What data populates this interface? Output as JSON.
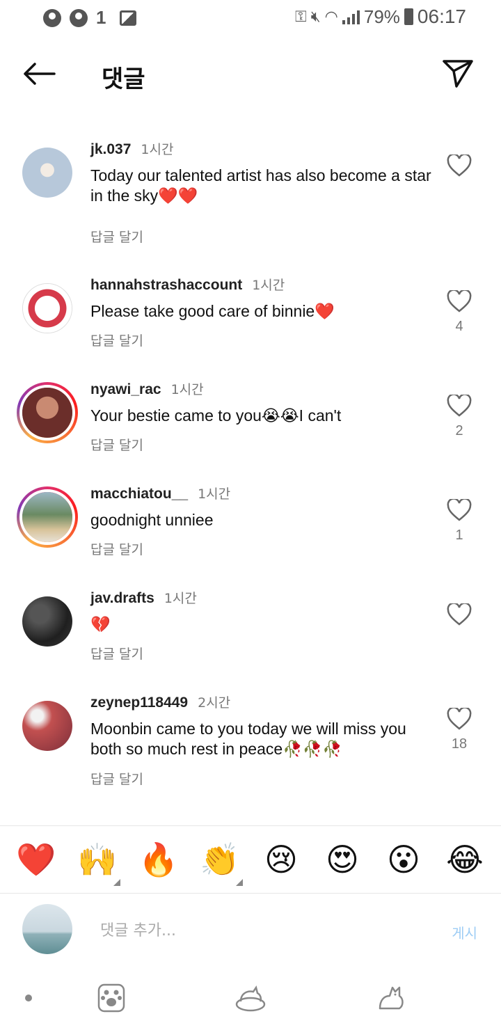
{
  "status_bar": {
    "notif_count": "1",
    "battery": "79%",
    "time": "06:17"
  },
  "header": {
    "title": "댓글"
  },
  "comments": [
    {
      "username": "jk.037",
      "time": "1시간",
      "text": "Today our talented artist has also become a star in the sky❤️❤️",
      "reply_label": "답글 달기",
      "likes": "",
      "avatar_color": "#b9c9d9"
    },
    {
      "username": "hannahstrashaccount",
      "time": "1시간",
      "text": "Please take good care of binnie❤️",
      "reply_label": "답글 달기",
      "likes": "4",
      "avatar_color": "#f1d6da"
    },
    {
      "username": "nyawi_rac",
      "time": "1시간",
      "text": "Your bestie came to you😭😭I can't",
      "reply_label": "답글 달기",
      "likes": "2",
      "avatar_color": "#7a3f36"
    },
    {
      "username": "macchiatou__",
      "time": "1시간",
      "text": "goodnight unniee",
      "reply_label": "답글 달기",
      "likes": "1",
      "avatar_color": "#5e7a58"
    },
    {
      "username": "jav.drafts",
      "time": "1시간",
      "text": "💔",
      "reply_label": "답글 달기",
      "likes": "",
      "avatar_color": "#2e2e2e"
    },
    {
      "username": "zeynep118449",
      "time": "2시간",
      "text": "Moonbin came to you today we will miss you both so much rest in peace🥀🥀🥀",
      "reply_label": "답글 달기",
      "likes": "18",
      "avatar_color": "#b24a4a"
    }
  ],
  "emoji_bar": [
    "❤️",
    "🙌",
    "🔥",
    "👏",
    "😢",
    "😍",
    "😮",
    "😂"
  ],
  "input": {
    "placeholder": "댓글 추가...",
    "post_label": "게시"
  },
  "colors": {
    "accent": "#0095f6",
    "post_disabled": "#9ecdf5",
    "story_ring": "#e1306c"
  }
}
